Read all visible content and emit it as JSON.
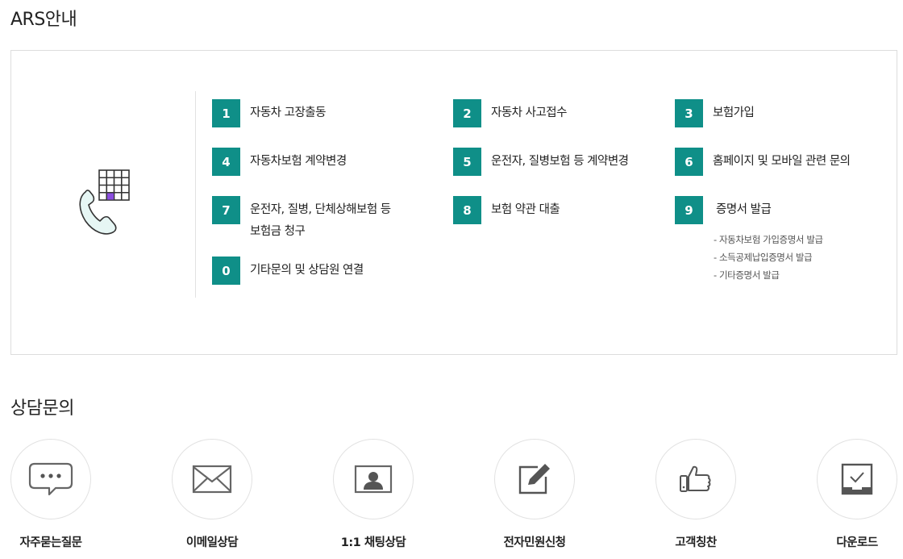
{
  "ars": {
    "title": "ARS안내",
    "items": [
      {
        "num": "1",
        "label": "자동차 고장출동"
      },
      {
        "num": "2",
        "label": "자동차 사고접수"
      },
      {
        "num": "3",
        "label": "보험가입"
      },
      {
        "num": "4",
        "label": "자동차보험 계약변경"
      },
      {
        "num": "5",
        "label": "운전자, 질병보험 등 계약변경"
      },
      {
        "num": "6",
        "label": "홈페이지 및 모바일 관련 문의"
      },
      {
        "num": "7",
        "label_line1": "운전자, 질병, 단체상해보험 등",
        "label_line2": "보험금 청구"
      },
      {
        "num": "8",
        "label": "보험 약관 대출"
      },
      {
        "num": "9",
        "label": "증명서 발급"
      },
      {
        "num": "0",
        "label": "기타문의 및 상담원 연결"
      }
    ],
    "certificate_sublist": [
      "- 자동차보험 가입증명서 발급",
      "- 소득공제납입증명서 발급",
      "- 기타증명서 발급"
    ],
    "accent_color": "#0f8f88"
  },
  "consult": {
    "title": "상담문의",
    "items": [
      {
        "label": "자주묻는질문",
        "icon": "speech-bubble-icon"
      },
      {
        "label": "이메일상담",
        "icon": "envelope-icon"
      },
      {
        "label": "1:1 채팅상담",
        "icon": "person-card-icon"
      },
      {
        "label": "전자민원신청",
        "icon": "edit-pencil-icon"
      },
      {
        "label": "고객칭찬",
        "icon": "thumbs-up-icon"
      },
      {
        "label": "다운로드",
        "icon": "download-tray-icon"
      }
    ]
  }
}
